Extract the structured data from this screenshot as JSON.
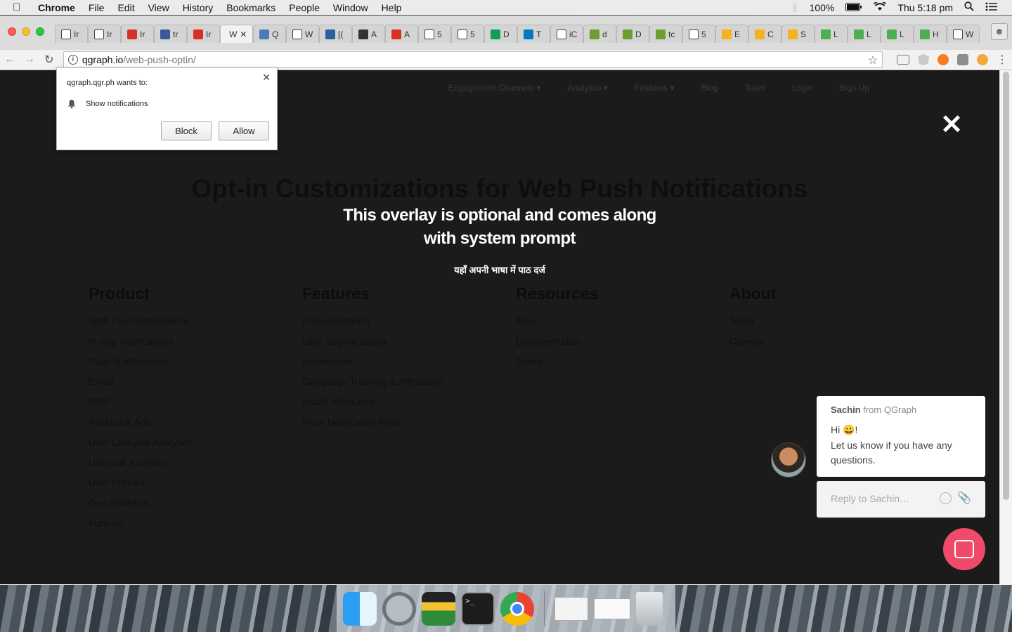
{
  "menubar": {
    "app_name": "Chrome",
    "menus": [
      "File",
      "Edit",
      "View",
      "History",
      "Bookmarks",
      "People",
      "Window",
      "Help"
    ],
    "battery": "100%",
    "clock": "Thu 5:18 pm"
  },
  "tabs": [
    {
      "label": "Ir",
      "icon": "doc-icon"
    },
    {
      "label": "Ir",
      "icon": "doc-icon"
    },
    {
      "label": "Ir",
      "icon": "gmail-icon"
    },
    {
      "label": "tr",
      "icon": "shield-icon"
    },
    {
      "label": "Ir",
      "icon": "gmail-icon"
    },
    {
      "label": "W",
      "icon": "none",
      "active": true
    },
    {
      "label": "Q",
      "icon": "qg-icon"
    },
    {
      "label": "W",
      "icon": "doc-icon"
    },
    {
      "label": "[(",
      "icon": "tool-icon"
    },
    {
      "label": "A",
      "icon": "apple-icon"
    },
    {
      "label": "A",
      "icon": "red-tag-icon"
    },
    {
      "label": "5",
      "icon": "doc-icon"
    },
    {
      "label": "5",
      "icon": "doc-icon"
    },
    {
      "label": "D",
      "icon": "sheets-icon"
    },
    {
      "label": "T",
      "icon": "trello-icon"
    },
    {
      "label": "iC",
      "icon": "doc-icon"
    },
    {
      "label": "d",
      "icon": "bars-icon"
    },
    {
      "label": "D",
      "icon": "bars-icon"
    },
    {
      "label": "tc",
      "icon": "bars-icon"
    },
    {
      "label": "5",
      "icon": "doc-icon"
    },
    {
      "label": "E",
      "icon": "box-icon"
    },
    {
      "label": "C",
      "icon": "box-icon"
    },
    {
      "label": "S",
      "icon": "box-icon"
    },
    {
      "label": "L",
      "icon": "leaf-icon"
    },
    {
      "label": "L",
      "icon": "leaf-icon"
    },
    {
      "label": "L",
      "icon": "leaf-icon"
    },
    {
      "label": "H",
      "icon": "leaf-icon"
    },
    {
      "label": "W",
      "icon": "doc-icon"
    }
  ],
  "omnibox": {
    "host": "qgraph.io",
    "path": "/web-push-optin/"
  },
  "site": {
    "nav": [
      "Engagement Channels ▾",
      "Analytics ▾",
      "Features ▾",
      "Blog",
      "Team",
      "Login",
      "Sign Up"
    ],
    "heading": "Opt-in Customizations for Web Push Notifications",
    "overlay_line1": "This overlay is optional and comes along",
    "overlay_line2": "with system prompt",
    "overlay_hindi": "यहाँ अपनी भाषा में पाठ दर्ज"
  },
  "footer": [
    {
      "title": "Product",
      "links": [
        "Web Push Notifications",
        "In-App Notifications",
        "Push Notifications",
        "Email",
        "SMS",
        "Facebook Ads",
        "User Lifecycle Analytics",
        "Uninstall Analytics",
        "User Profiles",
        "Geo Analytics",
        "Funnels"
      ]
    },
    {
      "title": "Features",
      "links": [
        "Personalization",
        "User Segmentation",
        "Automation",
        "Campaign Tracking & Attribution",
        "Install Attribution",
        "Push Notification Polls"
      ]
    },
    {
      "title": "Resources",
      "links": [
        "Blog",
        "Documentation",
        "Demo"
      ]
    },
    {
      "title": "About",
      "links": [
        "Team",
        "Careers"
      ]
    }
  ],
  "permission": {
    "title": "qgraph.qgr.ph wants to:",
    "item": "Show notifications",
    "block": "Block",
    "allow": "Allow"
  },
  "chat": {
    "sender": "Sachin",
    "from_suffix": "from QGraph",
    "greeting": "Hi 😀!",
    "message": "Let us know if you have any questions.",
    "reply_placeholder": "Reply to Sachin…"
  },
  "colors": {
    "launcher": "#f04a6a",
    "page_bg": "#1b1b1b"
  }
}
